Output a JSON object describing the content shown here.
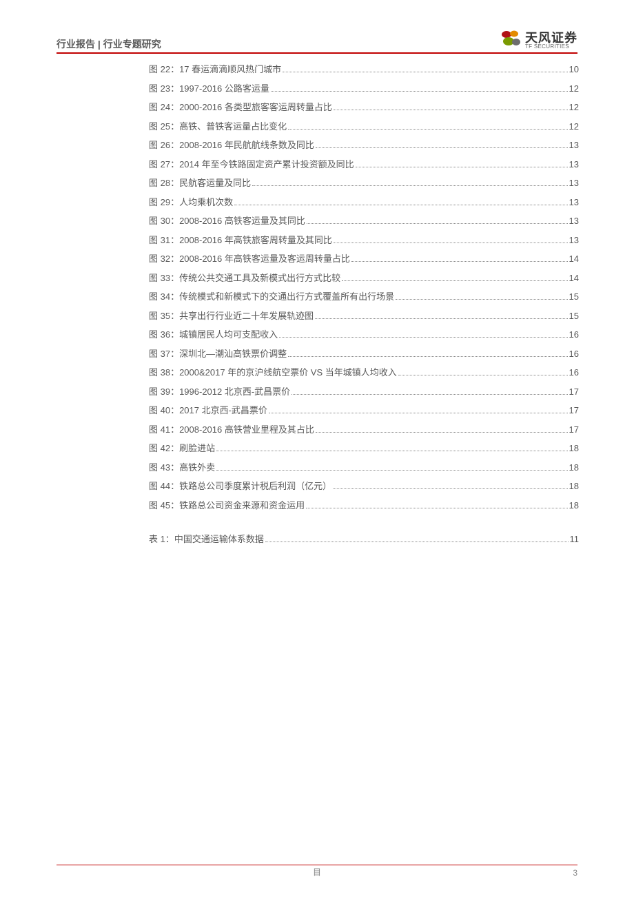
{
  "header": {
    "breadcrumb": "行业报告 | 行业专题研究",
    "brand_cn": "天风证券",
    "brand_en": "TF SECURITIES"
  },
  "toc": {
    "figures": [
      {
        "label": "图 22：17 春运滴滴顺风热门城市",
        "page": "10"
      },
      {
        "label": "图 23：1997-2016 公路客运量",
        "page": "12"
      },
      {
        "label": "图 24：2000-2016 各类型旅客客运周转量占比",
        "page": "12"
      },
      {
        "label": "图 25：高铁、普铁客运量占比变化",
        "page": "12"
      },
      {
        "label": "图 26：2008-2016 年民航航线条数及同比",
        "page": "13"
      },
      {
        "label": "图 27：2014 年至今铁路固定资产累计投资额及同比",
        "page": "13"
      },
      {
        "label": "图 28：民航客运量及同比",
        "page": "13"
      },
      {
        "label": "图 29：人均乘机次数",
        "page": "13"
      },
      {
        "label": "图 30：2008-2016 高铁客运量及其同比",
        "page": "13"
      },
      {
        "label": "图 31：2008-2016 年高铁旅客周转量及其同比",
        "page": "13"
      },
      {
        "label": "图 32：2008-2016 年高铁客运量及客运周转量占比",
        "page": "14"
      },
      {
        "label": "图 33：传统公共交通工具及新模式出行方式比较",
        "page": "14"
      },
      {
        "label": "图 34：传统模式和新模式下的交通出行方式覆盖所有出行场景",
        "page": "15"
      },
      {
        "label": "图 35：共享出行行业近二十年发展轨迹图",
        "page": "15"
      },
      {
        "label": "图 36：城镇居民人均可支配收入",
        "page": "16"
      },
      {
        "label": "图 37：深圳北—潮汕高铁票价调整",
        "page": "16"
      },
      {
        "label": "图 38：2000&2017 年的京沪线航空票价 VS 当年城镇人均收入",
        "page": "16"
      },
      {
        "label": "图 39：1996-2012 北京西-武昌票价",
        "page": "17"
      },
      {
        "label": "图 40：2017 北京西-武昌票价",
        "page": "17"
      },
      {
        "label": "图 41：2008-2016 高铁营业里程及其占比",
        "page": "17"
      },
      {
        "label": "图 42：刷脸进站",
        "page": "18"
      },
      {
        "label": "图 43：高铁外卖",
        "page": "18"
      },
      {
        "label": "图 44：铁路总公司季度累计税后利润（亿元）",
        "page": "18"
      },
      {
        "label": "图 45：铁路总公司资金来源和资金运用",
        "page": "18"
      }
    ],
    "tables": [
      {
        "label": "表 1：中国交通运输体系数据",
        "page": "11"
      }
    ]
  },
  "footer": {
    "center": "目",
    "page_no": "3"
  }
}
